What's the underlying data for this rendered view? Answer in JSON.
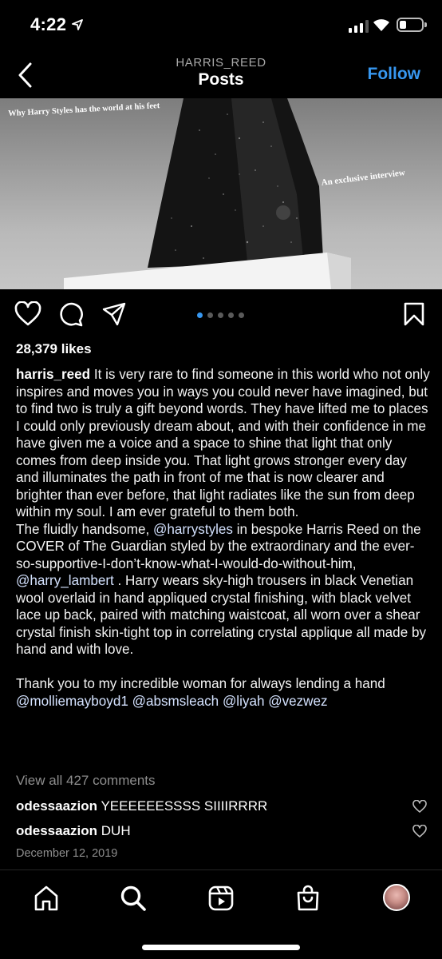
{
  "status_bar": {
    "time": "4:22"
  },
  "header": {
    "username": "HARRIS_REED",
    "title": "Posts",
    "follow_label": "Follow"
  },
  "post_image": {
    "headline": "Why Harry Styles has the world at his feet",
    "subhead": "An exclusive interview"
  },
  "carousel": {
    "count": 5,
    "active_index": 0
  },
  "likes": "28,379 likes",
  "caption": {
    "username": "harris_reed",
    "paragraph1": "It is very rare to find someone in this world who not only inspires and moves you in ways you could never have imagined, but to find two is truly a gift beyond words.  They have lifted me to places I could only previously dream about, and with their confidence in me have given me a voice and a space to shine that light that only comes from deep inside you. That light grows stronger every day and illuminates the path in front of me that is now clearer and brighter than ever before, that light radiates like the sun from deep within my soul. I am ever grateful to them both.",
    "p2_a": "The fluidly handsome, ",
    "p2_mention1": "@harrystyles",
    "p2_b": " in bespoke Harris Reed on the COVER of The Guardian styled by the extraordinary and the ever-so-supportive-I-don’t-know-what-I-would-do-without-him, ",
    "p2_mention2": "@harry_lambert",
    "p2_c": " . Harry wears sky-high trousers in black Venetian wool overlaid in hand appliqued crystal finishing, with black velvet lace up back, paired with matching waistcoat, all worn over a shear crystal finish skin-tight top in correlating crystal applique all made by hand and with love.",
    "p3_a": "Thank you to my incredible woman for always lending a hand ",
    "p3_m1": "@molliemayboyd1",
    "p3_m2": "@absmsleach",
    "p3_m3": "@liyah",
    "p3_m4": "@vezwez"
  },
  "view_comments": "View all 427 comments",
  "comments": [
    {
      "user": "odessaazion",
      "text": "YEEEEEESSSS SIIIIRRRR"
    },
    {
      "user": "odessaazion",
      "text": "DUH"
    }
  ],
  "date": "December 12, 2019",
  "colors": {
    "accent": "#3797f0",
    "background": "#000000",
    "muted": "#8e8e8e"
  }
}
